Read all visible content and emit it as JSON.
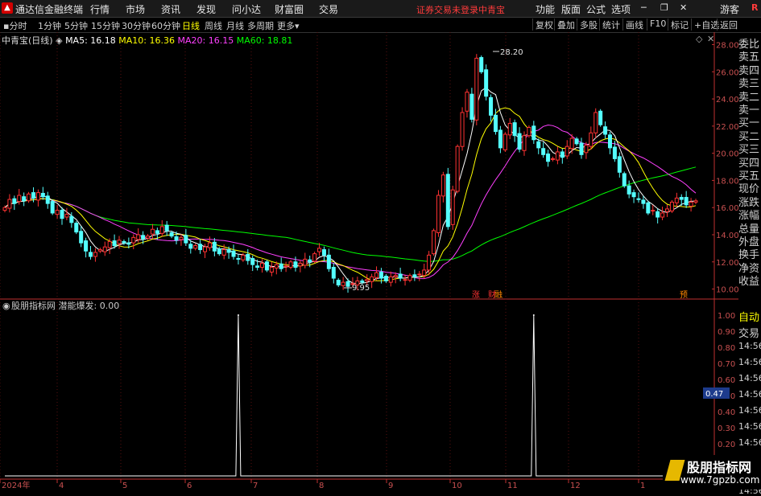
{
  "titlebar": {
    "app_name": "通达信金融终端",
    "menu": [
      "行情",
      "市场",
      "资讯",
      "发现",
      "问小达",
      "财富圈",
      "交易"
    ],
    "notice": "证券交易未登录",
    "stock": "中青宝",
    "right_menu": [
      "功能",
      "版面",
      "公式",
      "选项"
    ],
    "guest": "游客",
    "r_badge": "R"
  },
  "tabs": {
    "periods": [
      "分时",
      "1分钟",
      "5分钟",
      "15分钟",
      "30分钟",
      "60分钟",
      "日线",
      "周线",
      "月线",
      "多周期",
      "更多"
    ],
    "active": "日线",
    "right_buttons": [
      "复权",
      "叠加",
      "多股",
      "统计",
      "画线",
      "F10",
      "标记",
      "+自选",
      "返回"
    ]
  },
  "chart": {
    "title": "中青宝(日线)",
    "ma5": "MA5: 16.18",
    "ma10": "MA10: 16.36",
    "ma20": "MA20: 16.15",
    "ma60": "MA60: 18.81",
    "high_label": "28.20",
    "low_label": "9.95",
    "tag_zhang": "涨",
    "tag_cai": "财",
    "tag_rong": "融",
    "tag_yu": "预",
    "colors": {
      "ma5": "#ffffff",
      "ma10": "#ffff00",
      "ma20": "#ff40ff",
      "ma60": "#00ff00",
      "up": "#ff3232",
      "down": "#54ffff"
    }
  },
  "chart_data": [
    {
      "type": "candlestick",
      "title": "中青宝(日线)",
      "y_ticks": [
        "28.00",
        "26.00",
        "24.00",
        "22.00",
        "20.00",
        "18.00",
        "16.00",
        "14.00",
        "12.00",
        "10.00"
      ],
      "ylim": [
        9.5,
        28.8
      ],
      "x_ticks": [
        "2024年",
        "4",
        "5",
        "6",
        "7",
        "8",
        "9",
        "10",
        "11",
        "12",
        "1"
      ],
      "close": [
        16.0,
        16.6,
        16.3,
        16.9,
        16.5,
        17.0,
        16.7,
        17.1,
        16.8,
        16.3,
        15.6,
        15.8,
        15.2,
        15.5,
        14.9,
        14.2,
        13.4,
        12.8,
        12.4,
        12.7,
        12.9,
        13.1,
        13.5,
        13.2,
        13.6,
        13.4,
        13.3,
        13.8,
        14.0,
        13.7,
        13.9,
        14.4,
        14.1,
        14.6,
        14.3,
        13.9,
        13.6,
        13.8,
        13.4,
        13.0,
        13.2,
        12.9,
        13.1,
        13.4,
        12.8,
        12.6,
        12.9,
        12.7,
        12.4,
        12.2,
        12.5,
        12.1,
        11.8,
        11.6,
        11.9,
        11.4,
        11.6,
        11.8,
        11.5,
        11.7,
        12.0,
        11.6,
        11.9,
        12.2,
        12.0,
        12.6,
        13.0,
        12.5,
        11.5,
        10.8,
        10.3,
        10.5,
        10.2,
        10.4,
        10.6,
        10.5,
        10.7,
        10.9,
        11.2,
        10.8,
        10.6,
        10.9,
        11.0,
        10.8,
        10.7,
        11.0,
        10.9,
        11.1,
        11.4,
        12.5,
        14.3,
        16.9,
        18.4,
        14.6,
        17.3,
        20.5,
        23.0,
        24.5,
        22.5,
        27.0,
        26.0,
        24.2,
        22.8,
        21.6,
        20.4,
        21.4,
        22.2,
        21.3,
        20.3,
        21.3,
        21.9,
        21.0,
        20.4,
        19.9,
        19.4,
        19.6,
        20.1,
        19.7,
        20.5,
        21.1,
        20.7,
        19.9,
        20.6,
        21.5,
        23.0,
        22.1,
        21.4,
        20.4,
        19.6,
        18.6,
        17.6,
        17.0,
        16.8,
        16.6,
        16.3,
        15.6,
        15.8,
        15.3,
        15.6,
        15.9,
        16.4,
        16.7,
        16.6,
        16.2,
        16.4,
        16.5
      ],
      "ma_series": [
        "MA5",
        "MA10",
        "MA20",
        "MA60"
      ]
    },
    {
      "type": "line",
      "title": "股朋指标网 潜能爆发: 0.00",
      "y_ticks": [
        "1.00",
        "0.90",
        "0.80",
        "0.70",
        "0.60",
        "0.50",
        "0.40",
        "0.30",
        "0.20"
      ],
      "ylim": [
        0,
        1
      ],
      "spikes_at_index": [
        49,
        111
      ],
      "current": "0.47"
    }
  ],
  "indicator": {
    "title": "股朋指标网 潜能爆发: 0.00",
    "current_value": "0.47"
  },
  "right_panel": {
    "top_items": [
      "委比",
      "卖五",
      "卖四",
      "卖三",
      "卖二",
      "卖一",
      "买一",
      "买二",
      "买三",
      "买四",
      "买五",
      "现价",
      "涨跌",
      "涨幅",
      "总量",
      "外盘",
      "换手",
      "净资",
      "收益"
    ],
    "bottom_items": [
      "自动",
      "交易",
      "14:56",
      "14:56",
      "14:56",
      "14:56",
      "14:56",
      "14:56",
      "14:56",
      "14:56",
      "14:56",
      "14:56"
    ]
  },
  "watermark": {
    "line1": "股朋指标网",
    "line2": "www.7gpzb.com"
  }
}
